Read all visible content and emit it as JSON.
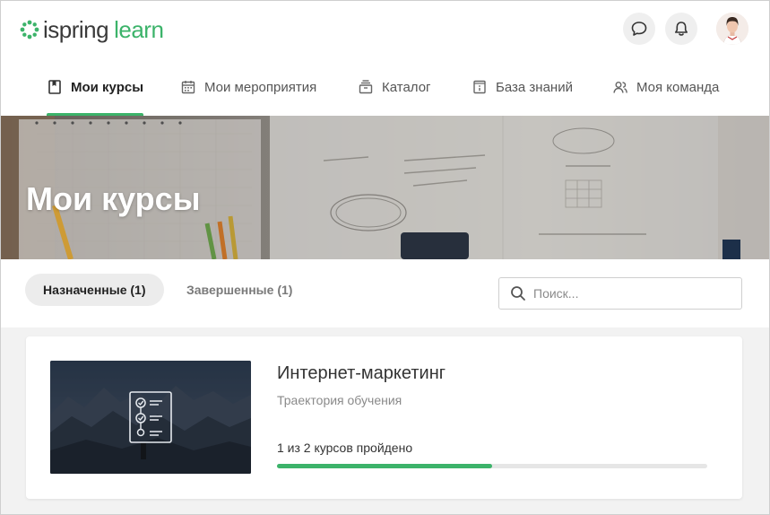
{
  "logo": {
    "word1": "ispring",
    "word2": "learn"
  },
  "header": {
    "chat_icon": "chat-bubble-icon",
    "bell_icon": "bell-icon",
    "avatar_icon": "user-avatar"
  },
  "nav": {
    "items": [
      {
        "label": "Мои курсы",
        "icon": "book-icon",
        "active": true
      },
      {
        "label": "Мои мероприятия",
        "icon": "calendar-icon",
        "active": false
      },
      {
        "label": "Каталог",
        "icon": "catalog-box-icon",
        "active": false
      },
      {
        "label": "База знаний",
        "icon": "info-book-icon",
        "active": false
      },
      {
        "label": "Моя команда",
        "icon": "team-icon",
        "active": false
      }
    ]
  },
  "hero": {
    "title": "Мои курсы"
  },
  "filters": {
    "tabs": [
      {
        "label": "Назначенные (1)",
        "active": true
      },
      {
        "label": "Завершенные (1)",
        "active": false
      }
    ],
    "search_placeholder": "Поиск..."
  },
  "courses": [
    {
      "title": "Интернет-маркетинг",
      "type": "Траектория обучения",
      "progress_text": "1 из 2 курсов пройдено",
      "progress_fraction": 0.5
    }
  ],
  "colors": {
    "accent": "#3cb36a",
    "text_dark": "#333333",
    "text_muted": "#8a8a8a"
  }
}
